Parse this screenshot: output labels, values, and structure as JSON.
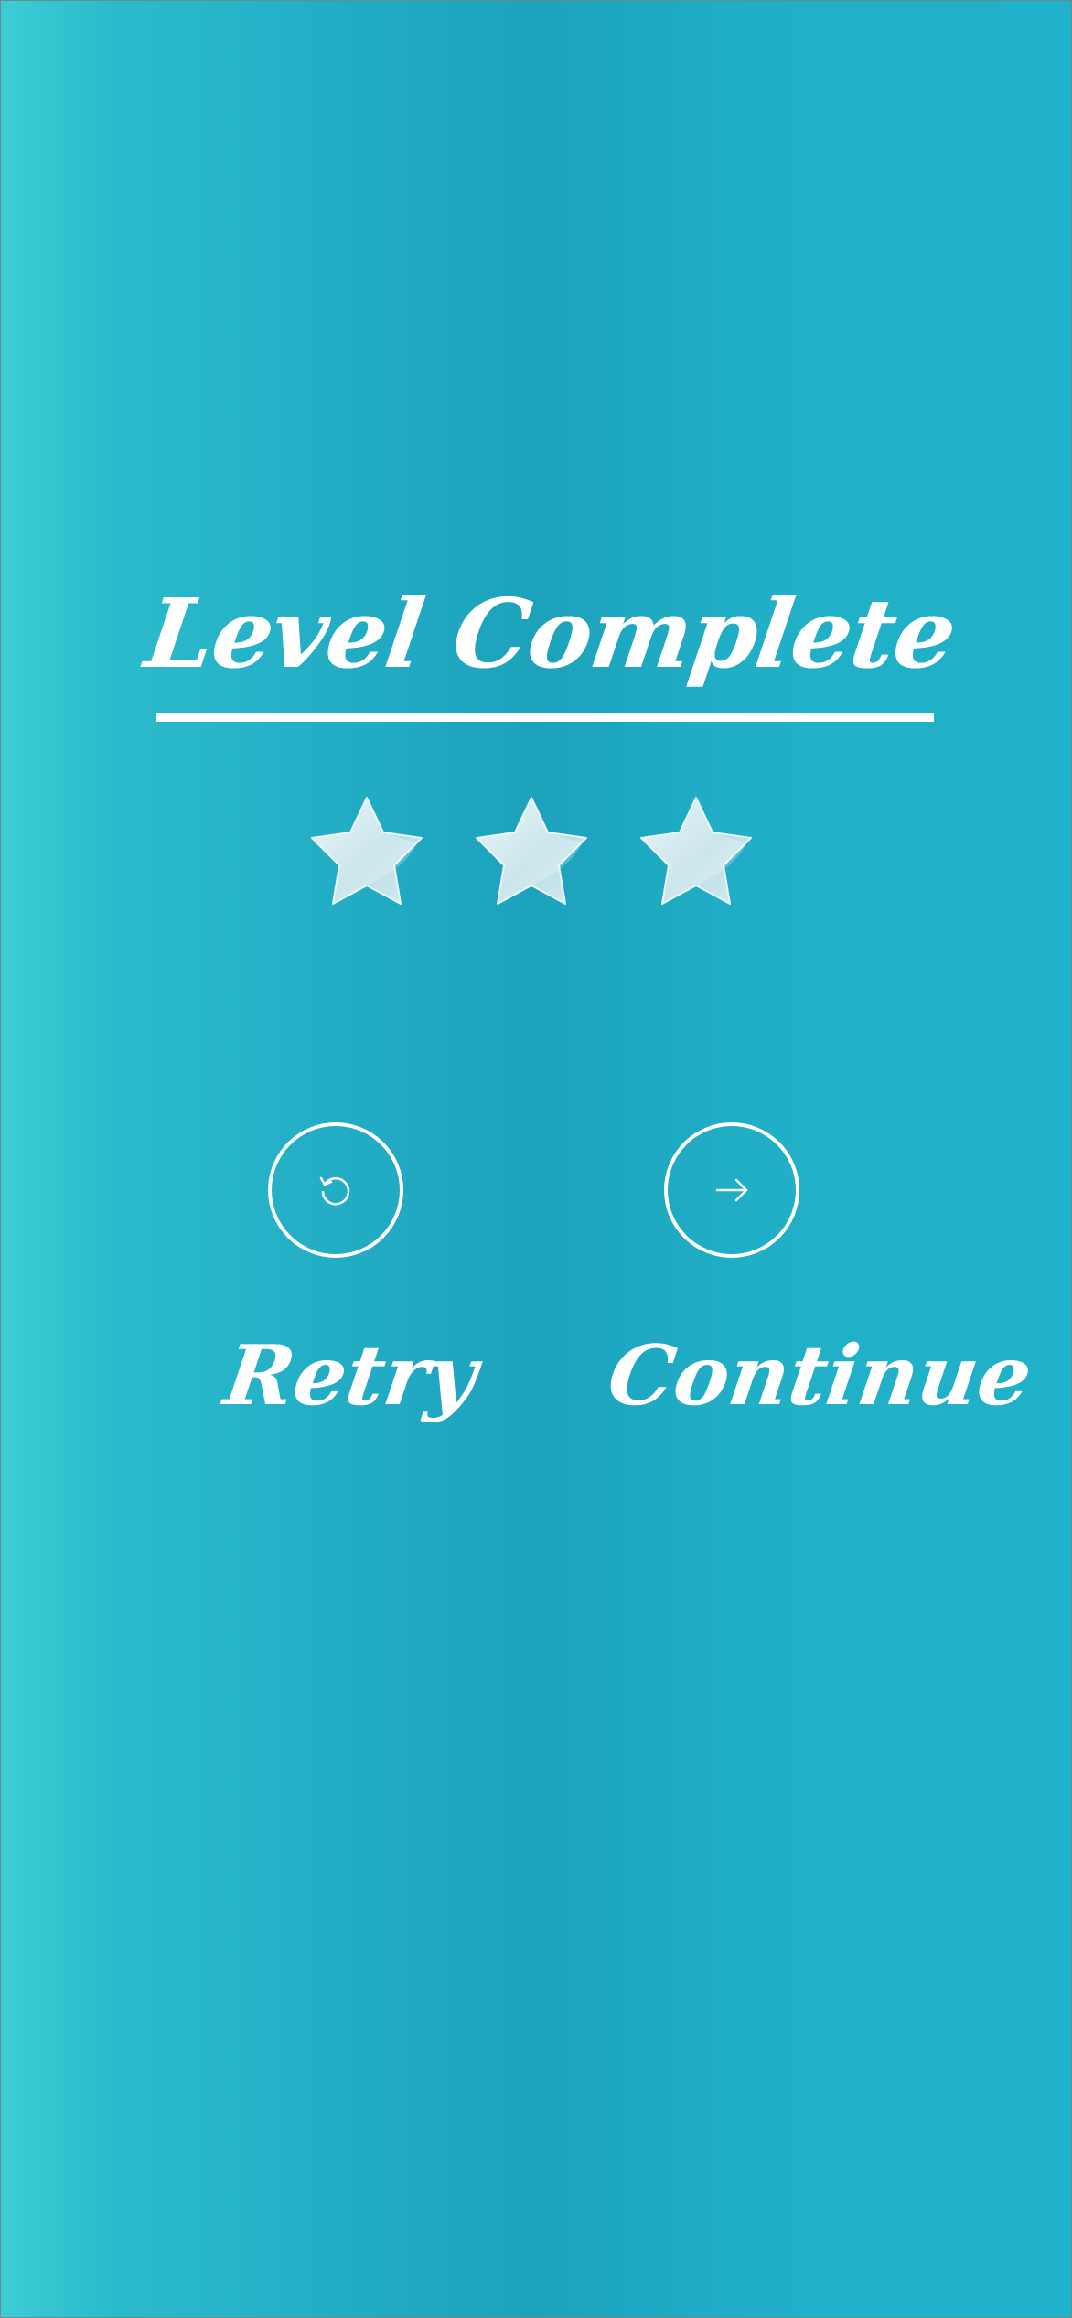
{
  "screen": {
    "title": "Level Complete",
    "stars": {
      "earned": 3,
      "total": 3
    }
  },
  "actions": {
    "retry_label": "Retry",
    "continue_label": "Continue"
  },
  "colors": {
    "background_left": "#3dcdd5",
    "background_mid": "#1da2bc",
    "background_right": "#20b2ca",
    "text": "#ffffff",
    "star_fill": "#cfe8ee"
  },
  "icons": {
    "retry": "retry-icon",
    "continue": "arrow-right-icon",
    "star": "star-icon"
  }
}
